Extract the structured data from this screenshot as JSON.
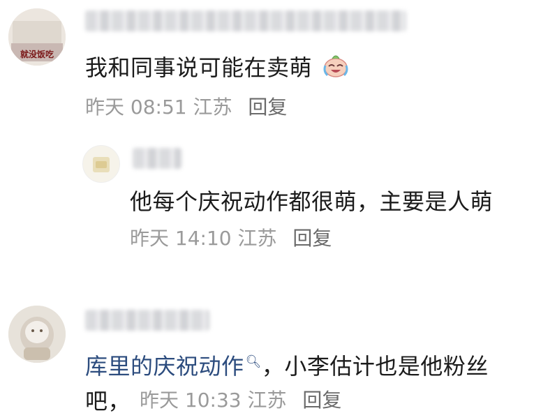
{
  "comments": [
    {
      "text": "我和同事说可能在卖萌",
      "time": "昨天 08:51",
      "location": "江苏",
      "reply_label": "回复"
    },
    {
      "text": "他每个庆祝动作都很萌，主要是人萌",
      "time": "昨天 14:10",
      "location": "江苏",
      "reply_label": "回复"
    },
    {
      "mention": "库里的庆祝动作",
      "text_rest": "，小李估计也是他粉丝",
      "text_line2": "吧，",
      "time": "昨天 10:33",
      "location": "江苏",
      "reply_label": "回复"
    }
  ],
  "avatar_texts": [
    "就没饭吃"
  ],
  "colors": {
    "text": "#1b1b1b",
    "meta": "#9a9a9a",
    "reply": "#6a6a6a",
    "mention": "#2c4c7e"
  },
  "icons": [
    "laughing-crying-emoji",
    "search-icon"
  ]
}
